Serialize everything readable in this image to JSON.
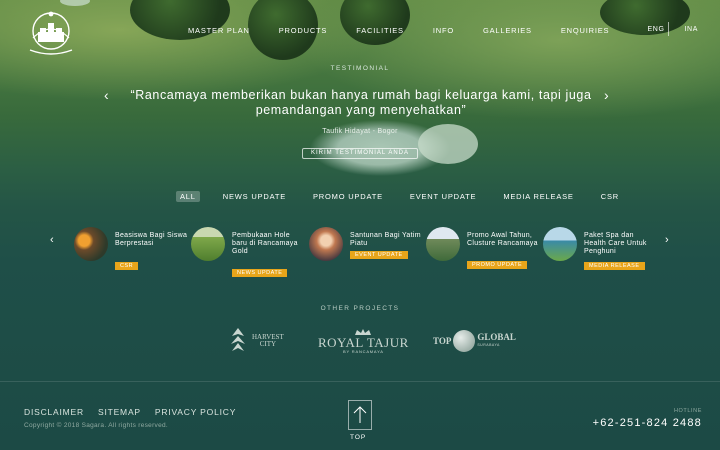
{
  "nav": {
    "items": [
      "MASTER PLAN",
      "PRODUCTS",
      "FACILITIES",
      "INFO",
      "GALLERIES",
      "ENQUIRIES"
    ]
  },
  "lang": {
    "eng": "ENG",
    "ina": "INA"
  },
  "testimonial": {
    "label": "TESTIMONIAL",
    "quote": "“Rancamaya memberikan bukan hanya rumah bagi keluarga kami, tapi juga pemandangan yang menyehatkan”",
    "author": "Taufik Hidayat - Bogor",
    "button": "KIRIM TESTIMONIAL ANDA",
    "prev": "‹",
    "next": "›"
  },
  "filters": [
    "ALL",
    "NEWS UPDATE",
    "PROMO UPDATE",
    "EVENT UPDATE",
    "MEDIA RELEASE",
    "CSR"
  ],
  "news": {
    "prev": "‹",
    "next": "›",
    "items": [
      {
        "title": "Beasiswa Bagi Siswa Berprestasi",
        "tag": "CSR"
      },
      {
        "title": "Pembukaan Hole baru di Rancamaya Gold",
        "tag": "NEWS UPDATE"
      },
      {
        "title": "Santunan Bagi Yatim Piatu",
        "tag": "EVENT UPDATE"
      },
      {
        "title": "Promo Awal Tahun, Clusture Rancamaya",
        "tag": "PROMO UPDATE"
      },
      {
        "title": "Paket Spa dan Health Care Untuk Penghuni",
        "tag": "MEDIA RELEASE"
      }
    ]
  },
  "other_projects": {
    "label": "OTHER PROJECTS",
    "harvest": {
      "line1": "HARVEST",
      "line2": "CITY"
    },
    "royal": {
      "name": "ROYAL TAJUR",
      "sub": "BY RANCAMAYA"
    },
    "top": {
      "left": "TOP",
      "right": "GLOBAL",
      "sub": "SURABAYA"
    }
  },
  "footer": {
    "links": [
      "DISCLAIMER",
      "SITEMAP",
      "PRIVACY POLICY"
    ],
    "copyright": "Copyright © 2018 Sagara. All rights reserved.",
    "top": "TOP",
    "hotline_label": "HOTLINE",
    "hotline": "+62-251-824 2488"
  },
  "colors": {
    "tag": "#e8a51a",
    "base": "#1c4a45"
  }
}
